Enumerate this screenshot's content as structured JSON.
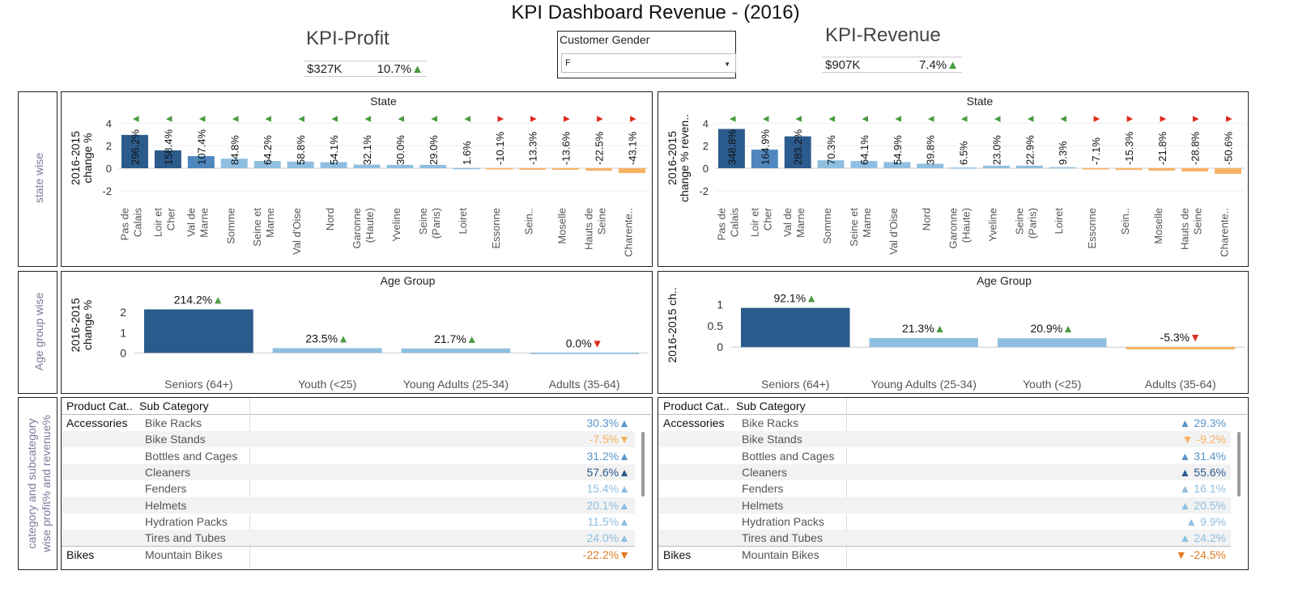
{
  "title": "KPI Dashboard Revenue - (2016)",
  "kpi_profit": {
    "name": "KPI-Profit",
    "value": "$327K",
    "change": "10.7%"
  },
  "kpi_revenue": {
    "name": "KPI-Revenue",
    "value": "$907K",
    "change": "7.4%"
  },
  "filter": {
    "label": "Customer Gender",
    "selected": "F"
  },
  "side_labels": {
    "state": "state wise",
    "age": "Age group wise",
    "category": [
      "category and subcategory",
      "wise profit% and revenue%"
    ]
  },
  "colors": {
    "dark_blue": "#2b5b8c",
    "mid_blue": "#4f87be",
    "light_blue": "#8ebfe0",
    "orange": "#f7b163",
    "up": "#4d9a44",
    "down": "#e02a1b"
  },
  "chart_data": [
    {
      "type": "bar",
      "title": "State",
      "ylabel": [
        "2016-2015",
        "change %"
      ],
      "yticks": [
        4,
        2,
        0,
        -2
      ],
      "ylim": [
        -2.8,
        4.6
      ],
      "categories": [
        "Pas de Calais",
        "Loir et Cher",
        "Val de Marne",
        "Somme",
        "Seine et Marne",
        "Val d'Oise",
        "Nord",
        "Garonne (Haute)",
        "Yveline",
        "Seine (Paris)",
        "Loiret",
        "Essonne",
        "Sein..",
        "Moselle",
        "Hauts de Seine",
        "Charente.."
      ],
      "category_lines": [
        [
          "Pas de",
          "Calais"
        ],
        [
          "Loir et",
          "Cher"
        ],
        [
          "Val de",
          "Marne"
        ],
        [
          "Somme"
        ],
        [
          "Seine et",
          "Marne"
        ],
        [
          "Val d'Oise"
        ],
        [
          "Nord"
        ],
        [
          "Garonne",
          "(Haute)"
        ],
        [
          "Yveline"
        ],
        [
          "Seine",
          "(Paris)"
        ],
        [
          "Loiret"
        ],
        [
          "Essonne"
        ],
        [
          "Sein.."
        ],
        [
          "Moselle"
        ],
        [
          "Hauts de",
          "Seine"
        ],
        [
          "Charente.."
        ]
      ],
      "values": [
        2.962,
        1.584,
        1.074,
        0.848,
        0.642,
        0.588,
        0.541,
        0.321,
        0.3,
        0.29,
        0.016,
        -0.101,
        -0.133,
        -0.136,
        -0.225,
        -0.431
      ],
      "labels": [
        "296.2%",
        "158.4%",
        "107.4%",
        "84.8%",
        "64.2%",
        "58.8%",
        "54.1%",
        "32.1%",
        "30.0%",
        "29.0%",
        "1.6%",
        "-10.1%",
        "-13.3%",
        "-13.6%",
        "-22.5%",
        "-43.1%"
      ]
    },
    {
      "type": "bar",
      "title": "State",
      "ylabel": [
        "2016-2015",
        "change % reven.."
      ],
      "yticks": [
        4,
        2,
        0,
        -2
      ],
      "ylim": [
        -2.8,
        4.6
      ],
      "categories": [
        "Pas de Calais",
        "Loir et Cher",
        "Val de Marne",
        "Somme",
        "Seine et Marne",
        "Val d'Oise",
        "Nord",
        "Garonne (Haute)",
        "Yveline",
        "Seine (Paris)",
        "Loiret",
        "Essonne",
        "Sein..",
        "Moselle",
        "Hauts de Seine",
        "Charente.."
      ],
      "category_lines": [
        [
          "Pas de",
          "Calais"
        ],
        [
          "Loir et",
          "Cher"
        ],
        [
          "Val de",
          "Marne"
        ],
        [
          "Somme"
        ],
        [
          "Seine et",
          "Marne"
        ],
        [
          "Val d'Oise"
        ],
        [
          "Nord"
        ],
        [
          "Garonne",
          "(Haute)"
        ],
        [
          "Yveline"
        ],
        [
          "Seine",
          "(Paris)"
        ],
        [
          "Loiret"
        ],
        [
          "Essonne"
        ],
        [
          "Sein.."
        ],
        [
          "Moselle"
        ],
        [
          "Hauts de",
          "Seine"
        ],
        [
          "Charente.."
        ]
      ],
      "values": [
        3.488,
        1.649,
        2.832,
        0.703,
        0.641,
        0.549,
        0.398,
        0.065,
        0.23,
        0.229,
        0.093,
        -0.071,
        -0.153,
        -0.218,
        -0.288,
        -0.506
      ],
      "labels": [
        "348.8%",
        "164.9%",
        "283.2%",
        "70.3%",
        "64.1%",
        "54.9%",
        "39.8%",
        "6.5%",
        "23.0%",
        "22.9%",
        "9.3%",
        "-7.1%",
        "-15.3%",
        "-21.8%",
        "-28.8%",
        "-50.6%"
      ]
    },
    {
      "type": "bar",
      "title": "Age Group",
      "ylabel": [
        "2016-2015",
        "change %"
      ],
      "yticks": [
        2,
        1,
        0
      ],
      "ylim": [
        -0.7,
        2.8
      ],
      "categories": [
        "Seniors (64+)",
        "Youth (<25)",
        "Young Adults (25-34)",
        "Adults (35-64)"
      ],
      "values": [
        2.142,
        0.235,
        0.217,
        0.0
      ],
      "labels": [
        "214.2%",
        "23.5%",
        "21.7%",
        "0.0%"
      ]
    },
    {
      "type": "bar",
      "title": "Age Group",
      "ylabel": [
        "2016-2015 ch.."
      ],
      "yticks": [
        1,
        0.5,
        0
      ],
      "ylim": [
        -0.47,
        1.2
      ],
      "categories": [
        "Seniors (64+)",
        "Young Adults (25-34)",
        "Youth (<25)",
        "Adults (35-64)"
      ],
      "values": [
        0.921,
        0.213,
        0.209,
        -0.053
      ],
      "labels": [
        "92.1%",
        "21.3%",
        "20.9%",
        "-5.3%"
      ]
    },
    {
      "type": "table",
      "columns": [
        "Product Cat..",
        "Sub Category"
      ],
      "rows": [
        {
          "cat": "Accessories",
          "sub": "Bike Racks",
          "value": 0.303,
          "label": "30.3%"
        },
        {
          "cat": "",
          "sub": "Bike Stands",
          "value": -0.075,
          "label": "-7.5%"
        },
        {
          "cat": "",
          "sub": "Bottles and Cages",
          "value": 0.312,
          "label": "31.2%"
        },
        {
          "cat": "",
          "sub": "Cleaners",
          "value": 0.576,
          "label": "57.6%"
        },
        {
          "cat": "",
          "sub": "Fenders",
          "value": 0.154,
          "label": "15.4%"
        },
        {
          "cat": "",
          "sub": "Helmets",
          "value": 0.201,
          "label": "20.1%"
        },
        {
          "cat": "",
          "sub": "Hydration Packs",
          "value": 0.115,
          "label": "11.5%"
        },
        {
          "cat": "",
          "sub": "Tires and Tubes",
          "value": 0.24,
          "label": "24.0%"
        },
        {
          "cat": "Bikes",
          "sub": "Mountain Bikes",
          "value": -0.222,
          "label": "-22.2%"
        }
      ]
    },
    {
      "type": "table",
      "columns": [
        "Product Cat..",
        "Sub Category"
      ],
      "rows": [
        {
          "cat": "Accessories",
          "sub": "Bike Racks",
          "value": 0.293,
          "label": "29.3%"
        },
        {
          "cat": "",
          "sub": "Bike Stands",
          "value": -0.092,
          "label": "-9.2%"
        },
        {
          "cat": "",
          "sub": "Bottles and Cages",
          "value": 0.314,
          "label": "31.4%"
        },
        {
          "cat": "",
          "sub": "Cleaners",
          "value": 0.556,
          "label": "55.6%"
        },
        {
          "cat": "",
          "sub": "Fenders",
          "value": 0.161,
          "label": "16.1%"
        },
        {
          "cat": "",
          "sub": "Helmets",
          "value": 0.205,
          "label": "20.5%"
        },
        {
          "cat": "",
          "sub": "Hydration Packs",
          "value": 0.099,
          "label": "9.9%"
        },
        {
          "cat": "",
          "sub": "Tires and Tubes",
          "value": 0.242,
          "label": "24.2%"
        },
        {
          "cat": "Bikes",
          "sub": "Mountain Bikes",
          "value": -0.245,
          "label": "-24.5%"
        }
      ]
    }
  ]
}
